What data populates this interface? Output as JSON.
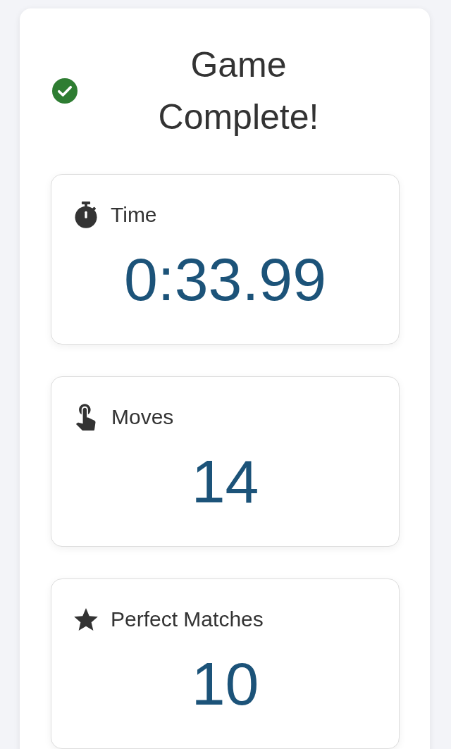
{
  "header": {
    "title": "Game Complete!"
  },
  "stats": [
    {
      "kind": "time",
      "label": "Time",
      "value": "0:33.99"
    },
    {
      "kind": "moves",
      "label": "Moves",
      "value": "14"
    },
    {
      "kind": "perfect",
      "label": "Perfect Matches",
      "value": "10"
    }
  ]
}
